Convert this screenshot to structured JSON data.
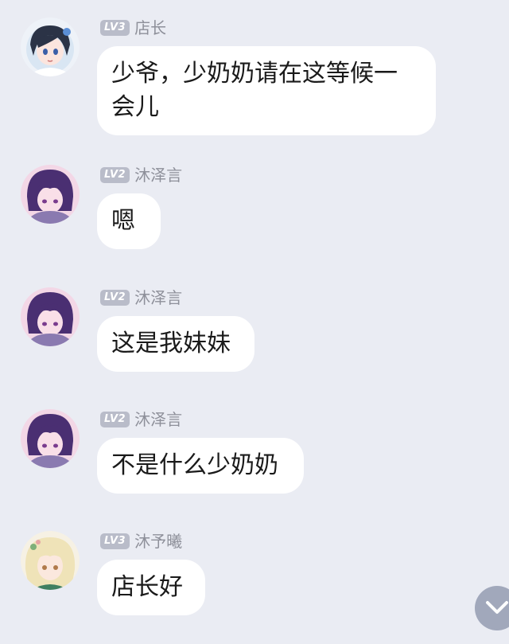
{
  "messages": [
    {
      "level": "LV3",
      "name": "店长",
      "text": "少爷，少奶奶请在这等候一\n会儿",
      "avatar": "shop-manager-avatar"
    },
    {
      "level": "LV2",
      "name": "沐泽言",
      "text": "嗯",
      "avatar": "muzeyan-avatar"
    },
    {
      "level": "LV2",
      "name": "沐泽言",
      "text": "这是我妹妹",
      "avatar": "muzeyan-avatar"
    },
    {
      "level": "LV2",
      "name": "沐泽言",
      "text": "不是什么少奶奶",
      "avatar": "muzeyan-avatar"
    },
    {
      "level": "LV3",
      "name": "沐予曦",
      "text": "店长好",
      "avatar": "muyuxi-avatar"
    }
  ],
  "scroll_button": {
    "icon": "chevron-down-icon"
  },
  "colors": {
    "background": "#eaecf3",
    "bubble": "#ffffff",
    "badge": "#b9bcc9",
    "name": "#8e909a"
  }
}
